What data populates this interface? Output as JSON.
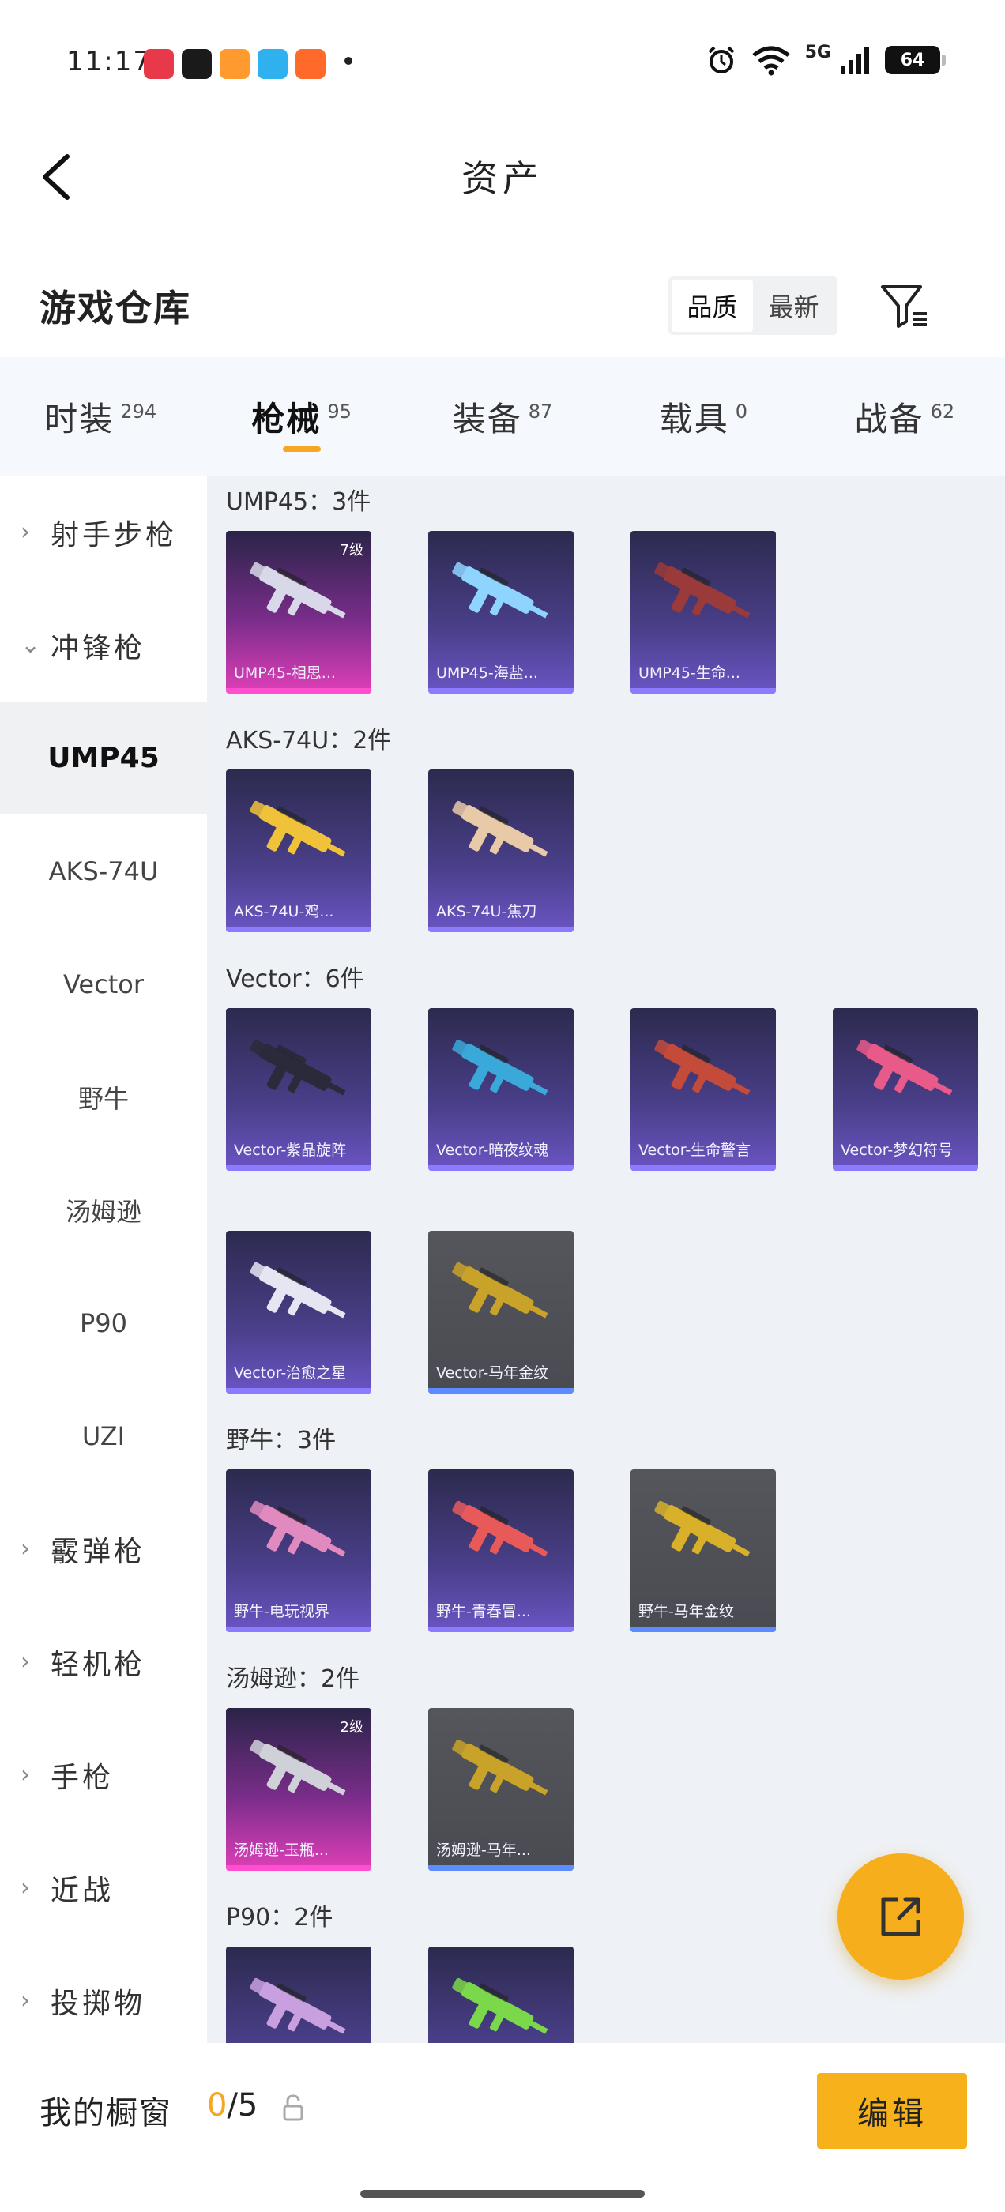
{
  "status_bar": {
    "time": "11:17",
    "network": "5G",
    "battery": "64",
    "app_icon_colors": [
      "#e8394a",
      "#1a1a1a",
      "#ff9a2e",
      "#2fb1f0",
      "#ff6a2b"
    ]
  },
  "nav": {
    "title": "资产",
    "back_icon": "chevron-left-icon"
  },
  "header": {
    "title": "游戏仓库",
    "sort_options": [
      "品质",
      "最新"
    ],
    "filter_icon": "filter-icon"
  },
  "tabs": [
    {
      "label": "时装",
      "count": "294"
    },
    {
      "label": "枪械",
      "count": "95",
      "active": true
    },
    {
      "label": "装备",
      "count": "87"
    },
    {
      "label": "载具",
      "count": "0"
    },
    {
      "label": "战备",
      "count": "62"
    }
  ],
  "sidebar": [
    {
      "label": "射手步枪",
      "type": "group",
      "expanded": false
    },
    {
      "label": "冲锋枪",
      "type": "group",
      "expanded": true
    },
    {
      "label": "UMP45",
      "type": "sub",
      "active": true
    },
    {
      "label": "AKS-74U",
      "type": "sub"
    },
    {
      "label": "Vector",
      "type": "sub"
    },
    {
      "label": "野牛",
      "type": "sub"
    },
    {
      "label": "汤姆逊",
      "type": "sub"
    },
    {
      "label": "P90",
      "type": "sub"
    },
    {
      "label": "UZI",
      "type": "sub"
    },
    {
      "label": "霰弹枪",
      "type": "group",
      "expanded": false
    },
    {
      "label": "轻机枪",
      "type": "group",
      "expanded": false
    },
    {
      "label": "手枪",
      "type": "group",
      "expanded": false
    },
    {
      "label": "近战",
      "type": "group",
      "expanded": false
    },
    {
      "label": "投掷物",
      "type": "group",
      "expanded": false
    }
  ],
  "sections": [
    {
      "title": "UMP45：3件",
      "items": [
        {
          "name": "UMP45-相思...",
          "rarity": "pink",
          "level": "7级",
          "gun_color": "#d8d8e8"
        },
        {
          "name": "UMP45-海盐...",
          "rarity": "purple",
          "gun_color": "#8fd3ff"
        },
        {
          "name": "UMP45-生命...",
          "rarity": "purple",
          "gun_color": "#9a3a3a"
        }
      ]
    },
    {
      "title": "AKS-74U：2件",
      "items": [
        {
          "name": "AKS-74U-鸡...",
          "rarity": "purple",
          "gun_color": "#f0c23a"
        },
        {
          "name": "AKS-74U-焦刀",
          "rarity": "purple",
          "gun_color": "#e8c9a8"
        }
      ]
    },
    {
      "title": "Vector：6件",
      "items": [
        {
          "name": "Vector-紫晶旋阵",
          "rarity": "purple",
          "gun_color": "#2a2a3a"
        },
        {
          "name": "Vector-暗夜纹魂",
          "rarity": "purple",
          "gun_color": "#3aa8d8"
        },
        {
          "name": "Vector-生命警言",
          "rarity": "purple",
          "gun_color": "#c44a3a"
        },
        {
          "name": "Vector-梦幻符号",
          "rarity": "purple",
          "gun_color": "#e85a8a"
        },
        {
          "name": "Vector-治愈之星",
          "rarity": "purple",
          "gun_color": "#e6e6f2"
        },
        {
          "name": "Vector-马年金纹",
          "rarity": "gray",
          "gun_color": "#c9a22a"
        }
      ]
    },
    {
      "title": "野牛：3件",
      "items": [
        {
          "name": "野牛-电玩视界",
          "rarity": "purple",
          "gun_color": "#e08ac0"
        },
        {
          "name": "野牛-青春冒...",
          "rarity": "purple",
          "gun_color": "#e85a5a"
        },
        {
          "name": "野牛-马年金纹",
          "rarity": "gray",
          "gun_color": "#d8b02a"
        }
      ]
    },
    {
      "title": "汤姆逊：2件",
      "items": [
        {
          "name": "汤姆逊-玉瓶...",
          "rarity": "pink",
          "level": "2级",
          "gun_color": "#d0d0d8"
        },
        {
          "name": "汤姆逊-马年...",
          "rarity": "gray",
          "gun_color": "#c9a22a"
        }
      ]
    },
    {
      "title": "P90：2件",
      "items": [
        {
          "name": "",
          "rarity": "purple",
          "gun_color": "#c8a0e0"
        },
        {
          "name": "",
          "rarity": "purple",
          "gun_color": "#7ad84a"
        }
      ]
    }
  ],
  "fab": {
    "icon": "share-external-icon",
    "color": "#f7ae1d"
  },
  "bottom_bar": {
    "label": "我的橱窗",
    "count_current": "0",
    "count_total": "/5",
    "lock_icon": "lock-icon",
    "edit_label": "编辑"
  }
}
